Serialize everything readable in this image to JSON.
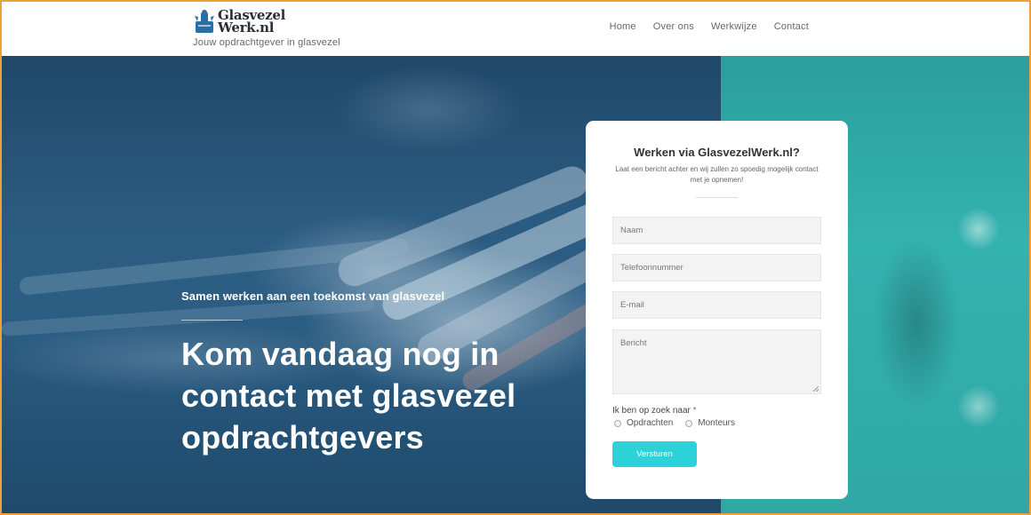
{
  "header": {
    "logo_line1": "Glasvezel",
    "logo_line2": "Werk.nl",
    "tagline": "Jouw opdrachtgever in glasvezel",
    "nav": [
      "Home",
      "Over ons",
      "Werkwijze",
      "Contact"
    ]
  },
  "hero": {
    "subtitle": "Samen werken aan een toekomst van glasvezel",
    "title": "Kom vandaag nog in contact met glasvezel opdrachtgevers"
  },
  "form": {
    "title": "Werken via GlasvezelWerk.nl?",
    "description": "Laat een bericht achter en wij zullen zo spoedig mogelijk contact met je opnemen!",
    "name_placeholder": "Naam",
    "phone_placeholder": "Telefoonnummer",
    "email_placeholder": "E-mail",
    "message_placeholder": "Bericht",
    "radio_label": "Ik ben op zoek naar",
    "required_mark": "*",
    "option_1": "Opdrachten",
    "option_2": "Monteurs",
    "submit_label": "Versturen"
  },
  "colors": {
    "accent": "#2dd1d8",
    "hero_blue": "#2b5b80",
    "hero_teal": "#34b2ae",
    "frame": "#f0a035"
  }
}
